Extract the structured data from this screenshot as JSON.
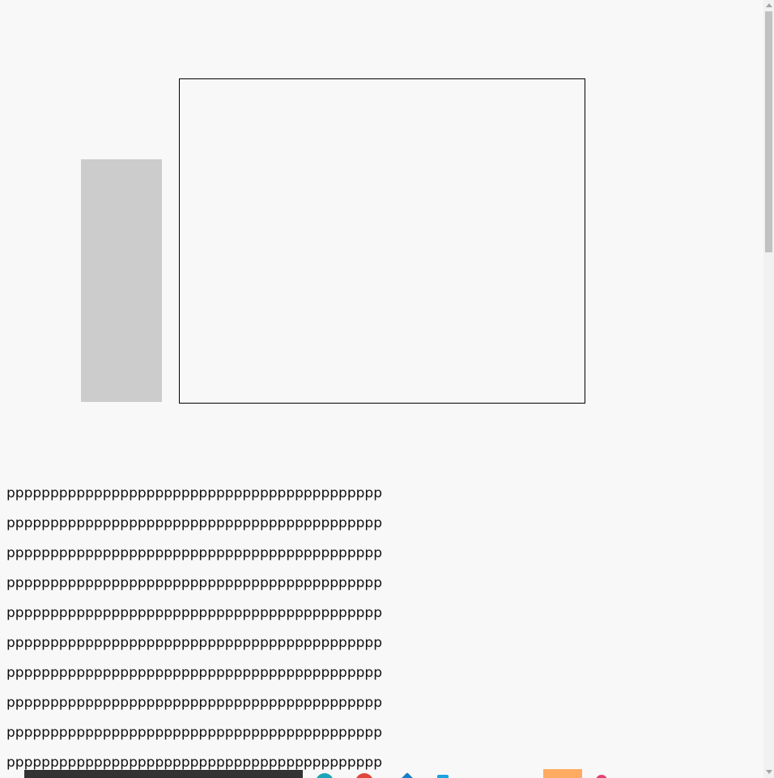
{
  "content": {
    "lines": [
      "ppppppppppppppppppppppppppppppppppppppppppp",
      "ppppppppppppppppppppppppppppppppppppppppppp",
      "ppppppppppppppppppppppppppppppppppppppppppp",
      "ppppppppppppppppppppppppppppppppppppppppppp",
      "ppppppppppppppppppppppppppppppppppppppppppp",
      "ppppppppppppppppppppppppppppppppppppppppppp",
      "ppppppppppppppppppppppppppppppppppppppppppp",
      "ppppppppppppppppppppppppppppppppppppppppppp",
      "ppppppppppppppppppppppppppppppppppppppppppp",
      "ppppppppppppppppppppppppppppppppppppppppppp"
    ]
  },
  "colors": {
    "background": "#f8f8f8",
    "side_block": "#cccccc",
    "frame_border": "#000000",
    "bottom_bar": "#333333",
    "orange_block": "#ffab62"
  },
  "icons": {
    "bottom": [
      "teal-circle-icon",
      "red-circle-icon",
      "blue-diamond-icon",
      "lightblue-square-icon",
      "pink-icon"
    ]
  }
}
